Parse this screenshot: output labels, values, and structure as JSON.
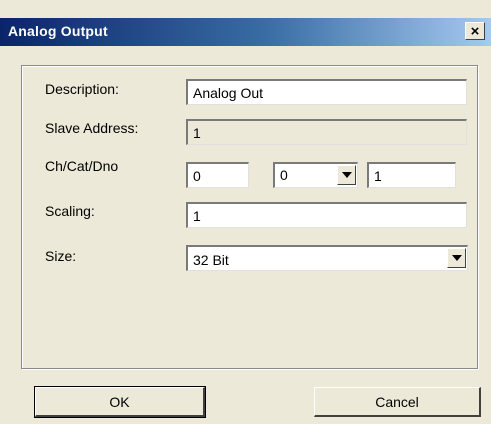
{
  "window": {
    "title": "Analog Output",
    "close_glyph": "×"
  },
  "form": {
    "description": {
      "label": "Description:",
      "value": "Analog Out"
    },
    "slave_address": {
      "label": "Slave Address:",
      "value": "1"
    },
    "ch_cat_dno": {
      "label": "Ch/Cat/Dno",
      "ch_value": "0",
      "cat_value": "0",
      "dno_value": "1"
    },
    "scaling": {
      "label": "Scaling:",
      "value": "1"
    },
    "size": {
      "label": "Size:",
      "value": "32 Bit"
    }
  },
  "buttons": {
    "ok_label": "OK",
    "cancel_label": "Cancel"
  },
  "icons": {
    "close": "close-icon",
    "dropdown": "chevron-down-icon"
  }
}
